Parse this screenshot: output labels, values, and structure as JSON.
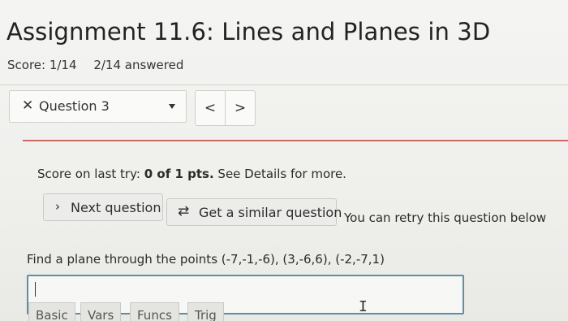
{
  "assignment": {
    "title": "Assignment 11.6: Lines and Planes in 3D",
    "score": "Score: 1/14",
    "answered": "2/14 answered"
  },
  "question_nav": {
    "selected": "Question 3",
    "status_icon": "x-icon",
    "prev_icon": "<",
    "next_icon": ">"
  },
  "result": {
    "prefix": "Score on last try:",
    "points": "0 of 1 pts.",
    "suffix": "See Details for more."
  },
  "actions": {
    "next_question": "Next question",
    "similar_question": "Get a similar question",
    "retry_note": "You can retry this question below"
  },
  "problem": {
    "text": "Find a plane through the points (-7,-1,-6), (3,-6,6), (-2,-7,1)",
    "answer_value": ""
  },
  "math_toolbar": {
    "tabs": [
      "Basic",
      "Vars",
      "Funcs",
      "Trig"
    ]
  },
  "colors": {
    "divider_accent": "#c96b63",
    "input_border": "#5f8fa3"
  }
}
